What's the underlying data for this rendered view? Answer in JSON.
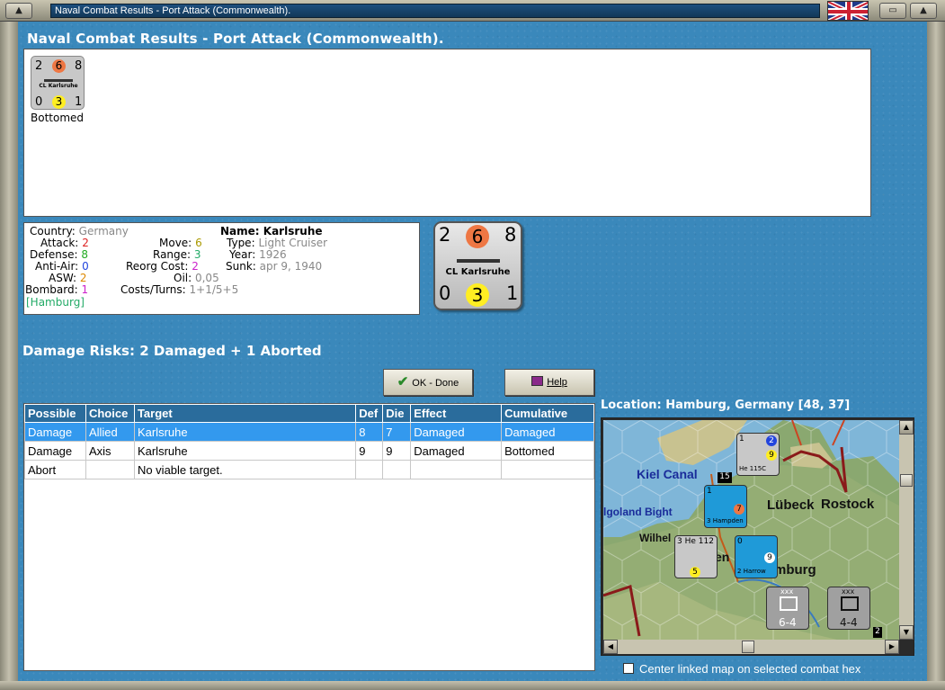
{
  "window": {
    "title": "Naval Combat Results - Port Attack (Commonwealth)."
  },
  "heading": "Naval Combat Results - Port Attack (Commonwealth).",
  "units": [
    {
      "attack": "2",
      "defense": "8",
      "movement": "6",
      "anti_air": "0",
      "factor": "3",
      "range_value": "1",
      "name": "CL Karlsruhe",
      "status": "Bottomed"
    }
  ],
  "info": {
    "country_label": "Country:",
    "country_value": "Germany",
    "attack_label": "Attack:",
    "attack_value": "2",
    "defense_label": "Defense:",
    "defense_value": "8",
    "antiair_label": "Anti-Air:",
    "antiair_value": "0",
    "asw_label": "ASW:",
    "asw_value": "2",
    "bombard_label": "Bombard:",
    "bombard_value": "1",
    "location": "[Hamburg]",
    "move_label": "Move:",
    "move_value": "6",
    "range_label": "Range:",
    "range_value": "3",
    "reorg_label": "Reorg Cost:",
    "reorg_value": "2",
    "oil_label": "Oil:",
    "oil_value": "0,05",
    "costs_label": "Costs/Turns:",
    "costs_value": "1+1/5+5",
    "name_label": "Name:",
    "name_value": "Karlsruhe",
    "type_label": "Type:",
    "type_value": "Light Cruiser",
    "year_label": "Year:",
    "year_value": "1926",
    "sunk_label": "Sunk:",
    "sunk_value": "apr 9, 1940"
  },
  "big_counter": {
    "attack": "2",
    "movement": "6",
    "defense": "8",
    "anti_air": "0",
    "factor": "3",
    "range_value": "1",
    "name": "CL Karlsruhe"
  },
  "damage_risks": "Damage Risks: 2 Damaged + 1 Aborted",
  "buttons": {
    "ok": "OK - Done",
    "help": "Help"
  },
  "table": {
    "headers": [
      "Possible",
      "Choice",
      "Target",
      "Def",
      "Die",
      "Effect",
      "Cumulative"
    ],
    "rows": [
      [
        "Damage",
        "Allied",
        "Karlsruhe",
        "8",
        "7",
        "Damaged",
        "Damaged"
      ],
      [
        "Damage",
        "Axis",
        "Karlsruhe",
        "9",
        "9",
        "Damaged",
        "Bottomed"
      ],
      [
        "Abort",
        "",
        "No viable target.",
        "",
        "",
        "",
        ""
      ]
    ]
  },
  "location": "Location:  Hamburg, Germany [48, 37]",
  "map": {
    "labels": {
      "kiel": "Kiel Canal",
      "lubeck": "Lübeck",
      "rostock": "Rostock",
      "heligoland": "lgoland Bight",
      "wilhel": "Wilhel",
      "hamburg": "mburg",
      "en": "en"
    },
    "counters": {
      "he115": {
        "top": "1",
        "badge": "2",
        "factor": "9",
        "name": "He 115C"
      },
      "hampden": {
        "top": "1",
        "factor": "7",
        "bottom": "3",
        "name": "Hampden"
      },
      "he112": {
        "top": "3",
        "name": "He 112",
        "factor": "5"
      },
      "harrow": {
        "top": "0",
        "factor": "9",
        "bottom": "2",
        "name": "Harrow"
      },
      "army1": {
        "size": "xxx",
        "strength": "6-4"
      },
      "army2": {
        "size": "xxx",
        "strength": "4-4"
      },
      "stack_count": "15",
      "corner_count": "2"
    }
  },
  "center_checkbox": "Center linked map on selected combat hex"
}
